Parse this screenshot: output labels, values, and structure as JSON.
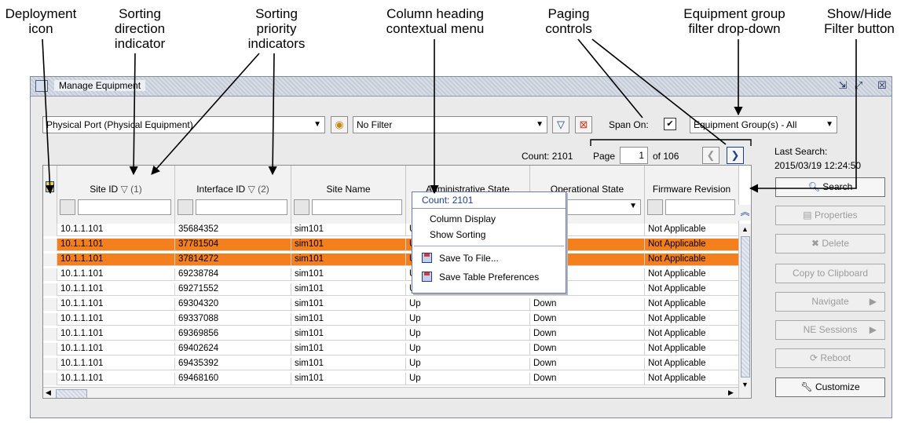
{
  "callouts": {
    "deployment_icon": "Deployment\nicon",
    "sorting_direction": "Sorting\ndirection\nindicator",
    "sorting_priority": "Sorting\npriority\nindicators",
    "column_heading_menu": "Column heading\ncontextual menu",
    "paging_controls": "Paging\ncontrols",
    "equipment_group_filter": "Equipment group\nfilter drop-down",
    "show_hide_filter": "Show/Hide\nFilter button"
  },
  "window": {
    "title": "Manage Equipment",
    "buttons": [
      "⇲",
      "⤢",
      "☒"
    ]
  },
  "toolbar": {
    "equipment_type": "Physical Port (Physical Equipment)",
    "filter": "No Filter",
    "span_on_label": "Span On:",
    "span_on_checked": true,
    "span_on_mark": "✔",
    "equipment_group": "Equipment Group(s) - All"
  },
  "paging": {
    "count": "Count: 2101",
    "page_label": "Page",
    "page_value": "1",
    "of_total": "of 106",
    "prev": "❮",
    "next": "❯"
  },
  "last_search": {
    "label": "Last Search:",
    "timestamp": "2015/03/19 12:24:50"
  },
  "table": {
    "columns": [
      {
        "label": "Site ID",
        "sort": "▽ (1)"
      },
      {
        "label": "Interface ID",
        "sort": "▽ (2)"
      },
      {
        "label": "Site Name",
        "sort": ""
      },
      {
        "label": "Administrative State",
        "sort": ""
      },
      {
        "label": "Operational State",
        "sort": ""
      },
      {
        "label": "Firmware Revision",
        "sort": ""
      }
    ],
    "rows": [
      {
        "selected": false,
        "cells": [
          "10.1.1.101",
          "35684352",
          "sim101",
          "Up",
          "",
          "Not Applicable"
        ]
      },
      {
        "selected": true,
        "cells": [
          "10.1.1.101",
          "37781504",
          "sim101",
          "U",
          "",
          "Not Applicable"
        ]
      },
      {
        "selected": true,
        "cells": [
          "10.1.1.101",
          "37814272",
          "sim101",
          "U",
          "",
          "Not Applicable"
        ]
      },
      {
        "selected": false,
        "cells": [
          "10.1.1.101",
          "69238784",
          "sim101",
          "U",
          "",
          "Not Applicable"
        ]
      },
      {
        "selected": false,
        "cells": [
          "10.1.1.101",
          "69271552",
          "sim101",
          "U",
          "",
          "Not Applicable"
        ]
      },
      {
        "selected": false,
        "cells": [
          "10.1.1.101",
          "69304320",
          "sim101",
          "Up",
          "Down",
          "Not Applicable"
        ]
      },
      {
        "selected": false,
        "cells": [
          "10.1.1.101",
          "69337088",
          "sim101",
          "Up",
          "Down",
          "Not Applicable"
        ]
      },
      {
        "selected": false,
        "cells": [
          "10.1.1.101",
          "69369856",
          "sim101",
          "Up",
          "Down",
          "Not Applicable"
        ]
      },
      {
        "selected": false,
        "cells": [
          "10.1.1.101",
          "69402624",
          "sim101",
          "Up",
          "Down",
          "Not Applicable"
        ]
      },
      {
        "selected": false,
        "cells": [
          "10.1.1.101",
          "69435392",
          "sim101",
          "Up",
          "Down",
          "Not Applicable"
        ]
      },
      {
        "selected": false,
        "cells": [
          "10.1.1.101",
          "69468160",
          "sim101",
          "Up",
          "Down",
          "Not Applicable"
        ]
      }
    ]
  },
  "context_menu": {
    "header": "Count: 2101",
    "items": [
      "Column Display",
      "Show Sorting",
      "Save To File...",
      "Save Table Preferences"
    ]
  },
  "side_buttons": [
    {
      "label": "Search",
      "enabled": true,
      "icon": "magnifier-icon"
    },
    {
      "label": "Properties",
      "enabled": false,
      "icon": "properties-icon"
    },
    {
      "label": "Delete",
      "enabled": false,
      "icon": "delete-icon"
    },
    {
      "label": "Copy to Clipboard",
      "enabled": false,
      "icon": ""
    },
    {
      "label": "Navigate",
      "enabled": false,
      "icon": ""
    },
    {
      "label": "NE Sessions",
      "enabled": false,
      "icon": ""
    },
    {
      "label": "Reboot",
      "enabled": false,
      "icon": "reboot-icon"
    },
    {
      "label": "Customize",
      "enabled": true,
      "icon": "wrench-icon"
    }
  ],
  "colors": {
    "selected_row": "#f47f1d",
    "accent_blue": "#1d3f8f"
  }
}
